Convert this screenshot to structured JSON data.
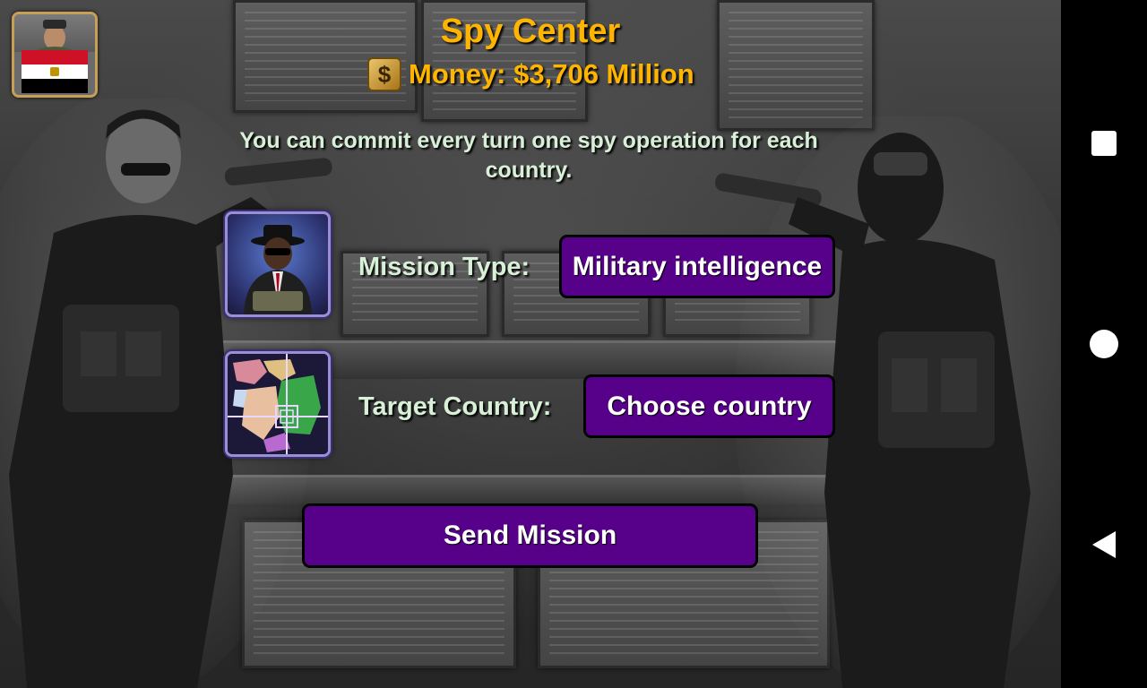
{
  "header": {
    "title": "Spy Center",
    "money_icon": "dollar-icon",
    "money_text": "Money: $3,706 Million"
  },
  "info_text": "You can commit every turn one spy operation for each country.",
  "mission": {
    "type_label": "Mission Type:",
    "type_value": "Military intelligence",
    "target_label": "Target Country:",
    "target_value": "Choose country",
    "send_label": "Send Mission"
  },
  "player": {
    "flag": "egypt-flag",
    "colors": {
      "red": "#ce1126",
      "white": "#ffffff",
      "black": "#000000"
    }
  },
  "navbar": {
    "recent": "recent-apps-icon",
    "home": "home-icon",
    "back": "back-icon"
  },
  "theme": {
    "gold": "#ffb400",
    "text": "#d8f0d8",
    "button": "#57008a"
  }
}
